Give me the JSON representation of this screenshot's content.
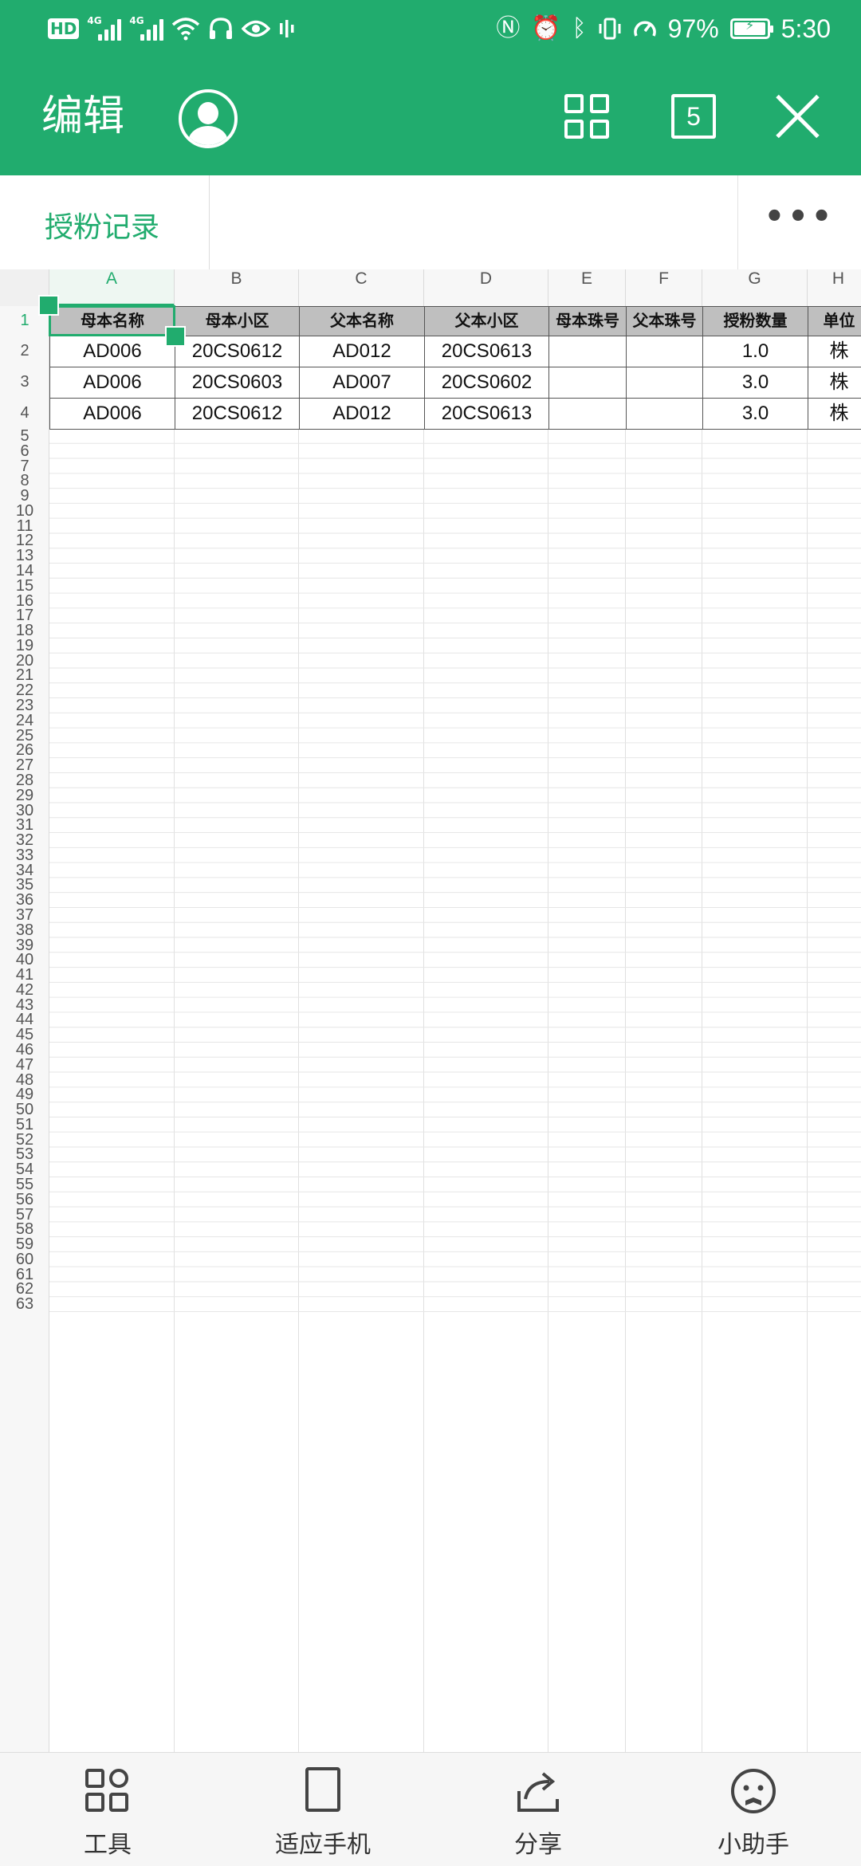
{
  "status_bar": {
    "hd_label": "HD",
    "sim1_label": "4G",
    "sim2_label": "4G",
    "battery_percent": "97%",
    "battery_level": 0.97,
    "time": "5:30",
    "icons": [
      "hd-icon",
      "signal-icon",
      "wifi-icon",
      "headphones-icon",
      "eye-icon",
      "vibrate-icon",
      "nfc-icon",
      "alarm-icon",
      "bluetooth-icon",
      "vibrate-mode-icon",
      "speed-icon",
      "battery-icon"
    ]
  },
  "app_bar": {
    "title": "编辑",
    "sheet_count": "5",
    "icons": [
      "avatar-icon",
      "grid-view-icon",
      "sheets-count-icon",
      "close-icon"
    ]
  },
  "tab_bar": {
    "active_sheet": "授粉记录",
    "more_label": "•••"
  },
  "spreadsheet": {
    "columns": [
      "A",
      "B",
      "C",
      "D",
      "E",
      "F",
      "G",
      "H"
    ],
    "active_column": "A",
    "active_row": 1,
    "row_count": 63,
    "header_row": [
      "母本名称",
      "母本小区",
      "父本名称",
      "父本小区",
      "母本珠号",
      "父本珠号",
      "授粉数量",
      "单位"
    ],
    "rows": [
      [
        "AD006",
        "20CS0612",
        "AD012",
        "20CS0613",
        "",
        "",
        "1.0",
        "株"
      ],
      [
        "AD006",
        "20CS0603",
        "AD007",
        "20CS0602",
        "",
        "",
        "3.0",
        "株"
      ],
      [
        "AD006",
        "20CS0612",
        "AD012",
        "20CS0613",
        "",
        "",
        "3.0",
        "株"
      ]
    ]
  },
  "bottom_bar": {
    "items": [
      {
        "label": "工具",
        "icon": "tools-icon"
      },
      {
        "label": "适应手机",
        "icon": "fit-phone-icon"
      },
      {
        "label": "分享",
        "icon": "share-icon"
      },
      {
        "label": "小助手",
        "icon": "assistant-icon"
      }
    ]
  }
}
